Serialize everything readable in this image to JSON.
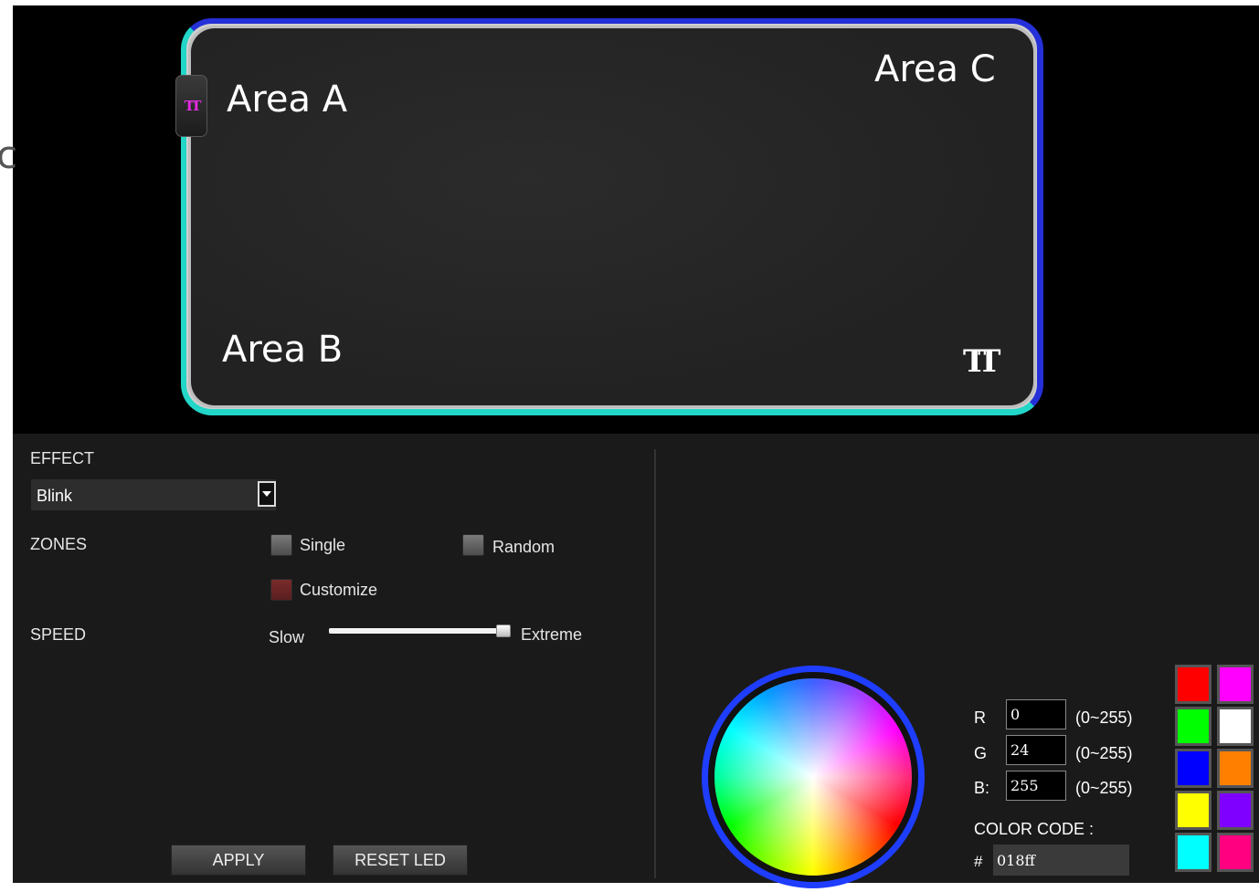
{
  "preview": {
    "area_a": "Area A",
    "area_b": "Area B",
    "area_c": "Area C",
    "stray_glyph": "c",
    "hub_logo": "TT",
    "pad_logo": "TT",
    "edge_colors": {
      "area_c": "#2530d8",
      "area_ab": "#22d6c8"
    }
  },
  "effect": {
    "label": "EFFECT",
    "selected": "Blink"
  },
  "zones": {
    "label": "ZONES",
    "single": "Single",
    "random": "Random",
    "customize": "Customize",
    "checked": "Customize"
  },
  "speed": {
    "label": "SPEED",
    "min_label": "Slow",
    "max_label": "Extreme",
    "value": 0.93
  },
  "buttons": {
    "apply": "APPLY",
    "reset": "RESET LED"
  },
  "color": {
    "r_label": "R",
    "g_label": "G",
    "b_label": "B:",
    "r_value": "0",
    "g_value": "24",
    "b_value": "255",
    "range": "(0~255)",
    "code_label": "COLOR CODE :",
    "hash": "#",
    "code_value": "018ff",
    "wheel_ring_color": "#1f3dff"
  },
  "swatches": [
    "#ff0000",
    "#ff00ff",
    "#00ff00",
    "#ffffff",
    "#0000ff",
    "#ff8000",
    "#ffff00",
    "#8000ff",
    "#00ffff",
    "#ff0080"
  ]
}
